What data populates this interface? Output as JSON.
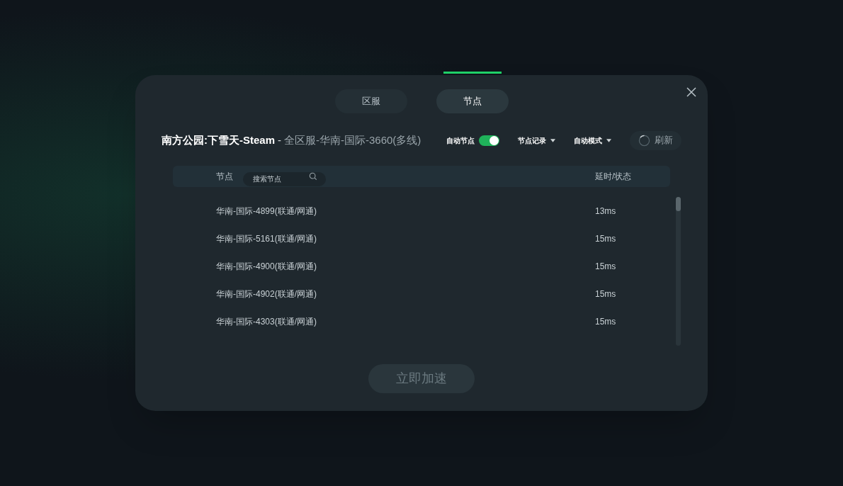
{
  "tabs": [
    {
      "label": "区服",
      "selected": false
    },
    {
      "label": "节点",
      "selected": true
    }
  ],
  "header": {
    "game": "南方公园:下雪天-Steam",
    "separator": "-",
    "route": "全区服-华南-国际-3660(多线)"
  },
  "auto_node": {
    "label": "自动节点",
    "on": true
  },
  "dropdowns": [
    "节点记录",
    "自动模式"
  ],
  "refresh": {
    "label": "刷新"
  },
  "table": {
    "columns": [
      "节点",
      "延时/状态"
    ],
    "search": {
      "placeholder": "搜索节点"
    },
    "rows": [
      {
        "node": "华南-国际-4899(联通/网通)",
        "latency": "13ms"
      },
      {
        "node": "华南-国际-5161(联通/网通)",
        "latency": "15ms"
      },
      {
        "node": "华南-国际-4900(联通/网通)",
        "latency": "15ms"
      },
      {
        "node": "华南-国际-4902(联通/网通)",
        "latency": "15ms"
      },
      {
        "node": "华南-国际-4303(联通/网通)",
        "latency": "15ms"
      }
    ]
  },
  "accelerate_button": {
    "label": "立即加速",
    "disabled": true
  }
}
